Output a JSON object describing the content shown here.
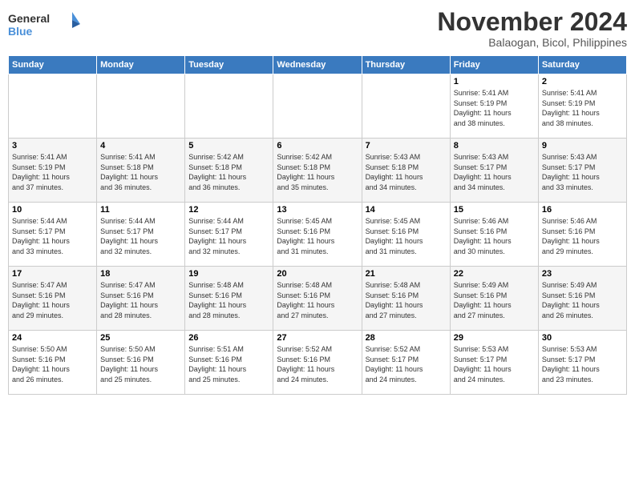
{
  "logo": {
    "line1": "General",
    "line2": "Blue"
  },
  "title": "November 2024",
  "location": "Balaogan, Bicol, Philippines",
  "weekdays": [
    "Sunday",
    "Monday",
    "Tuesday",
    "Wednesday",
    "Thursday",
    "Friday",
    "Saturday"
  ],
  "weeks": [
    [
      {
        "day": "",
        "info": ""
      },
      {
        "day": "",
        "info": ""
      },
      {
        "day": "",
        "info": ""
      },
      {
        "day": "",
        "info": ""
      },
      {
        "day": "",
        "info": ""
      },
      {
        "day": "1",
        "info": "Sunrise: 5:41 AM\nSunset: 5:19 PM\nDaylight: 11 hours\nand 38 minutes."
      },
      {
        "day": "2",
        "info": "Sunrise: 5:41 AM\nSunset: 5:19 PM\nDaylight: 11 hours\nand 38 minutes."
      }
    ],
    [
      {
        "day": "3",
        "info": "Sunrise: 5:41 AM\nSunset: 5:19 PM\nDaylight: 11 hours\nand 37 minutes."
      },
      {
        "day": "4",
        "info": "Sunrise: 5:41 AM\nSunset: 5:18 PM\nDaylight: 11 hours\nand 36 minutes."
      },
      {
        "day": "5",
        "info": "Sunrise: 5:42 AM\nSunset: 5:18 PM\nDaylight: 11 hours\nand 36 minutes."
      },
      {
        "day": "6",
        "info": "Sunrise: 5:42 AM\nSunset: 5:18 PM\nDaylight: 11 hours\nand 35 minutes."
      },
      {
        "day": "7",
        "info": "Sunrise: 5:43 AM\nSunset: 5:18 PM\nDaylight: 11 hours\nand 34 minutes."
      },
      {
        "day": "8",
        "info": "Sunrise: 5:43 AM\nSunset: 5:17 PM\nDaylight: 11 hours\nand 34 minutes."
      },
      {
        "day": "9",
        "info": "Sunrise: 5:43 AM\nSunset: 5:17 PM\nDaylight: 11 hours\nand 33 minutes."
      }
    ],
    [
      {
        "day": "10",
        "info": "Sunrise: 5:44 AM\nSunset: 5:17 PM\nDaylight: 11 hours\nand 33 minutes."
      },
      {
        "day": "11",
        "info": "Sunrise: 5:44 AM\nSunset: 5:17 PM\nDaylight: 11 hours\nand 32 minutes."
      },
      {
        "day": "12",
        "info": "Sunrise: 5:44 AM\nSunset: 5:17 PM\nDaylight: 11 hours\nand 32 minutes."
      },
      {
        "day": "13",
        "info": "Sunrise: 5:45 AM\nSunset: 5:16 PM\nDaylight: 11 hours\nand 31 minutes."
      },
      {
        "day": "14",
        "info": "Sunrise: 5:45 AM\nSunset: 5:16 PM\nDaylight: 11 hours\nand 31 minutes."
      },
      {
        "day": "15",
        "info": "Sunrise: 5:46 AM\nSunset: 5:16 PM\nDaylight: 11 hours\nand 30 minutes."
      },
      {
        "day": "16",
        "info": "Sunrise: 5:46 AM\nSunset: 5:16 PM\nDaylight: 11 hours\nand 29 minutes."
      }
    ],
    [
      {
        "day": "17",
        "info": "Sunrise: 5:47 AM\nSunset: 5:16 PM\nDaylight: 11 hours\nand 29 minutes."
      },
      {
        "day": "18",
        "info": "Sunrise: 5:47 AM\nSunset: 5:16 PM\nDaylight: 11 hours\nand 28 minutes."
      },
      {
        "day": "19",
        "info": "Sunrise: 5:48 AM\nSunset: 5:16 PM\nDaylight: 11 hours\nand 28 minutes."
      },
      {
        "day": "20",
        "info": "Sunrise: 5:48 AM\nSunset: 5:16 PM\nDaylight: 11 hours\nand 27 minutes."
      },
      {
        "day": "21",
        "info": "Sunrise: 5:48 AM\nSunset: 5:16 PM\nDaylight: 11 hours\nand 27 minutes."
      },
      {
        "day": "22",
        "info": "Sunrise: 5:49 AM\nSunset: 5:16 PM\nDaylight: 11 hours\nand 27 minutes."
      },
      {
        "day": "23",
        "info": "Sunrise: 5:49 AM\nSunset: 5:16 PM\nDaylight: 11 hours\nand 26 minutes."
      }
    ],
    [
      {
        "day": "24",
        "info": "Sunrise: 5:50 AM\nSunset: 5:16 PM\nDaylight: 11 hours\nand 26 minutes."
      },
      {
        "day": "25",
        "info": "Sunrise: 5:50 AM\nSunset: 5:16 PM\nDaylight: 11 hours\nand 25 minutes."
      },
      {
        "day": "26",
        "info": "Sunrise: 5:51 AM\nSunset: 5:16 PM\nDaylight: 11 hours\nand 25 minutes."
      },
      {
        "day": "27",
        "info": "Sunrise: 5:52 AM\nSunset: 5:16 PM\nDaylight: 11 hours\nand 24 minutes."
      },
      {
        "day": "28",
        "info": "Sunrise: 5:52 AM\nSunset: 5:17 PM\nDaylight: 11 hours\nand 24 minutes."
      },
      {
        "day": "29",
        "info": "Sunrise: 5:53 AM\nSunset: 5:17 PM\nDaylight: 11 hours\nand 24 minutes."
      },
      {
        "day": "30",
        "info": "Sunrise: 5:53 AM\nSunset: 5:17 PM\nDaylight: 11 hours\nand 23 minutes."
      }
    ]
  ]
}
